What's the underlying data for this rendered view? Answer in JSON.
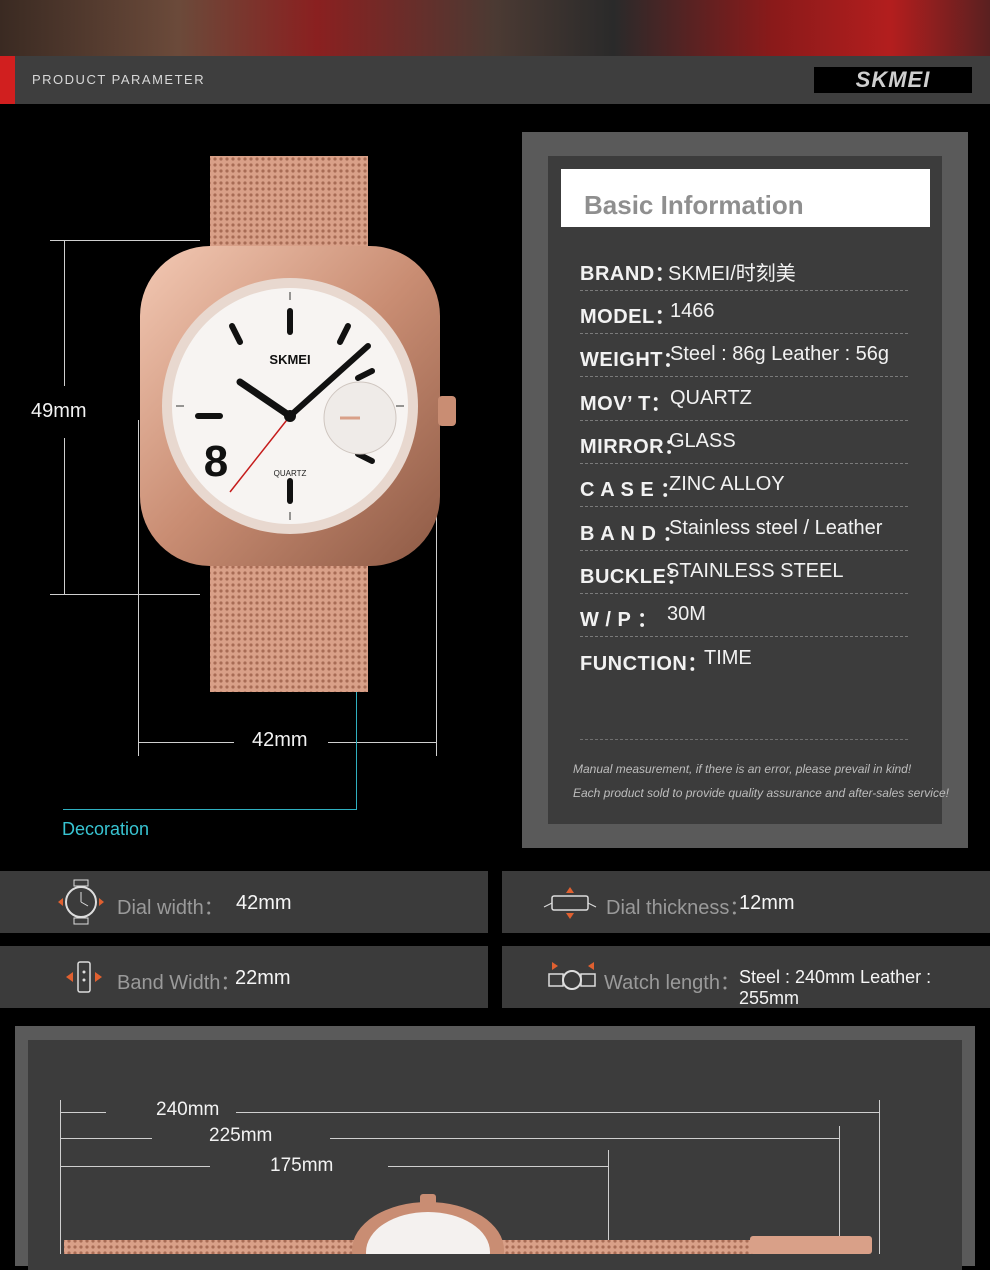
{
  "header": {
    "title": "PRODUCT PARAMETER",
    "brand_logo": "SKMEI"
  },
  "dimensions": {
    "height": "49mm",
    "width": "42mm",
    "decoration_label": "Decoration"
  },
  "watch_face": {
    "brand": "SKMEI",
    "movement_label": "QUARTZ",
    "numeral": "8"
  },
  "info": {
    "title": "Basic Information",
    "rows": [
      {
        "label": "BRAND：",
        "value": "SKMEI/时刻美"
      },
      {
        "label": "MODEL：",
        "value": "1466"
      },
      {
        "label": "WEIGHT：",
        "value": "Steel : 86g   Leather : 56g"
      },
      {
        "label": "MOV’ T：",
        "value": "QUARTZ"
      },
      {
        "label": "MIRROR：",
        "value": "GLASS"
      },
      {
        "label": "C A S E ：",
        "value": "ZINC ALLOY"
      },
      {
        "label": "B A N D ：",
        "value": "Stainless steel  / Leather"
      },
      {
        "label": "BUCKLE：",
        "value": "STAINLESS STEEL"
      },
      {
        "label": "W  /  P  ：",
        "value": "30M"
      },
      {
        "label": "FUNCTION：",
        "value": "TIME"
      }
    ],
    "notes": [
      "Manual measurement, if there is an error, please prevail in kind!",
      "Each product sold to provide quality assurance and after-sales service!"
    ]
  },
  "stats": {
    "dial_width": {
      "label": "Dial width：",
      "value": "42mm",
      "icon": "dial-width-icon"
    },
    "dial_thickness": {
      "label": "Dial thickness：",
      "value": "12mm",
      "icon": "dial-thickness-icon"
    },
    "band_width": {
      "label": "Band Width：",
      "value": "22mm",
      "icon": "band-width-icon"
    },
    "watch_length": {
      "label": "Watch length：",
      "value": "Steel : 240mm   Leather : 255mm",
      "icon": "watch-length-icon"
    }
  },
  "lengths": {
    "total": "240mm",
    "mid": "225mm",
    "short": "175mm"
  },
  "colors": {
    "accent_red": "#d11f1f",
    "accent_cyan": "#38c4d2",
    "rose_gold": "#d9a088"
  }
}
